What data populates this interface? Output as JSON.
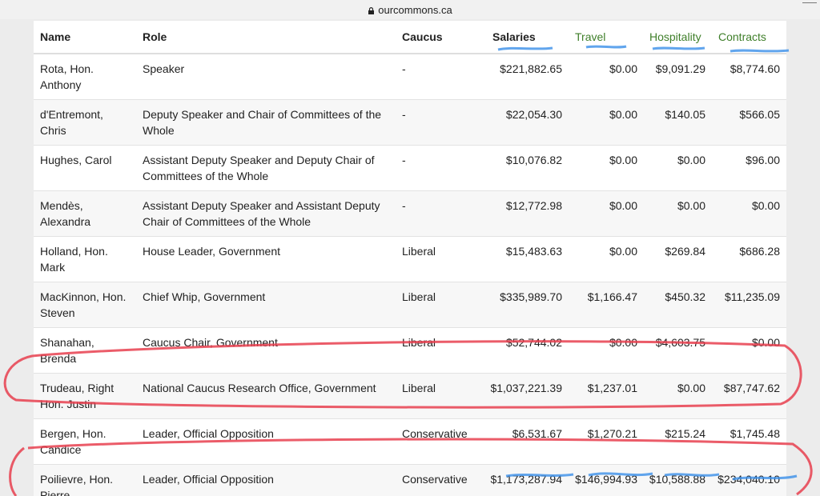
{
  "browser": {
    "domain": "ourcommons.ca"
  },
  "table": {
    "headers": {
      "name": "Name",
      "role": "Role",
      "caucus": "Caucus",
      "salaries": "Salaries",
      "travel": "Travel",
      "hospitality": "Hospitality",
      "contracts": "Contracts"
    },
    "rows": [
      {
        "name": "Rota, Hon. Anthony",
        "role": "Speaker",
        "caucus": "-",
        "salaries": "$221,882.65",
        "travel": "$0.00",
        "hospitality": "$9,091.29",
        "contracts": "$8,774.60"
      },
      {
        "name": "d'Entremont, Chris",
        "role": "Deputy Speaker and Chair of Committees of the Whole",
        "caucus": "-",
        "salaries": "$22,054.30",
        "travel": "$0.00",
        "hospitality": "$140.05",
        "contracts": "$566.05"
      },
      {
        "name": "Hughes, Carol",
        "role": "Assistant Deputy Speaker and Deputy Chair of Committees of the Whole",
        "caucus": "-",
        "salaries": "$10,076.82",
        "travel": "$0.00",
        "hospitality": "$0.00",
        "contracts": "$96.00"
      },
      {
        "name": "Mendès, Alexandra",
        "role": "Assistant Deputy Speaker and Assistant Deputy Chair of Committees of the Whole",
        "caucus": "-",
        "salaries": "$12,772.98",
        "travel": "$0.00",
        "hospitality": "$0.00",
        "contracts": "$0.00"
      },
      {
        "name": "Holland, Hon. Mark",
        "role": "House Leader, Government",
        "caucus": "Liberal",
        "salaries": "$15,483.63",
        "travel": "$0.00",
        "hospitality": "$269.84",
        "contracts": "$686.28"
      },
      {
        "name": "MacKinnon, Hon. Steven",
        "role": "Chief Whip, Government",
        "caucus": "Liberal",
        "salaries": "$335,989.70",
        "travel": "$1,166.47",
        "hospitality": "$450.32",
        "contracts": "$11,235.09"
      },
      {
        "name": "Shanahan, Brenda",
        "role": "Caucus Chair, Government",
        "caucus": "Liberal",
        "salaries": "$52,744.02",
        "travel": "$0.00",
        "hospitality": "$4,603.75",
        "contracts": "$0.00"
      },
      {
        "name": "Trudeau, Right Hon. Justin",
        "role": "National Caucus Research Office, Government",
        "caucus": "Liberal",
        "salaries": "$1,037,221.39",
        "travel": "$1,237.01",
        "hospitality": "$0.00",
        "contracts": "$87,747.62"
      },
      {
        "name": "Bergen, Hon. Candice",
        "role": "Leader, Official Opposition",
        "caucus": "Conservative",
        "salaries": "$6,531.67",
        "travel": "$1,270.21",
        "hospitality": "$215.24",
        "contracts": "$1,745.48"
      },
      {
        "name": "Poilievre, Hon. Pierre",
        "role": "Leader, Official Opposition",
        "caucus": "Conservative",
        "salaries": "$1,173,287.94",
        "travel": "$146,994.93",
        "hospitality": "$10,588.88",
        "contracts": "$234,040.10"
      }
    ]
  },
  "annotations": {
    "circle_color": "#e8404f",
    "underline_color": "#3a8ee8"
  }
}
